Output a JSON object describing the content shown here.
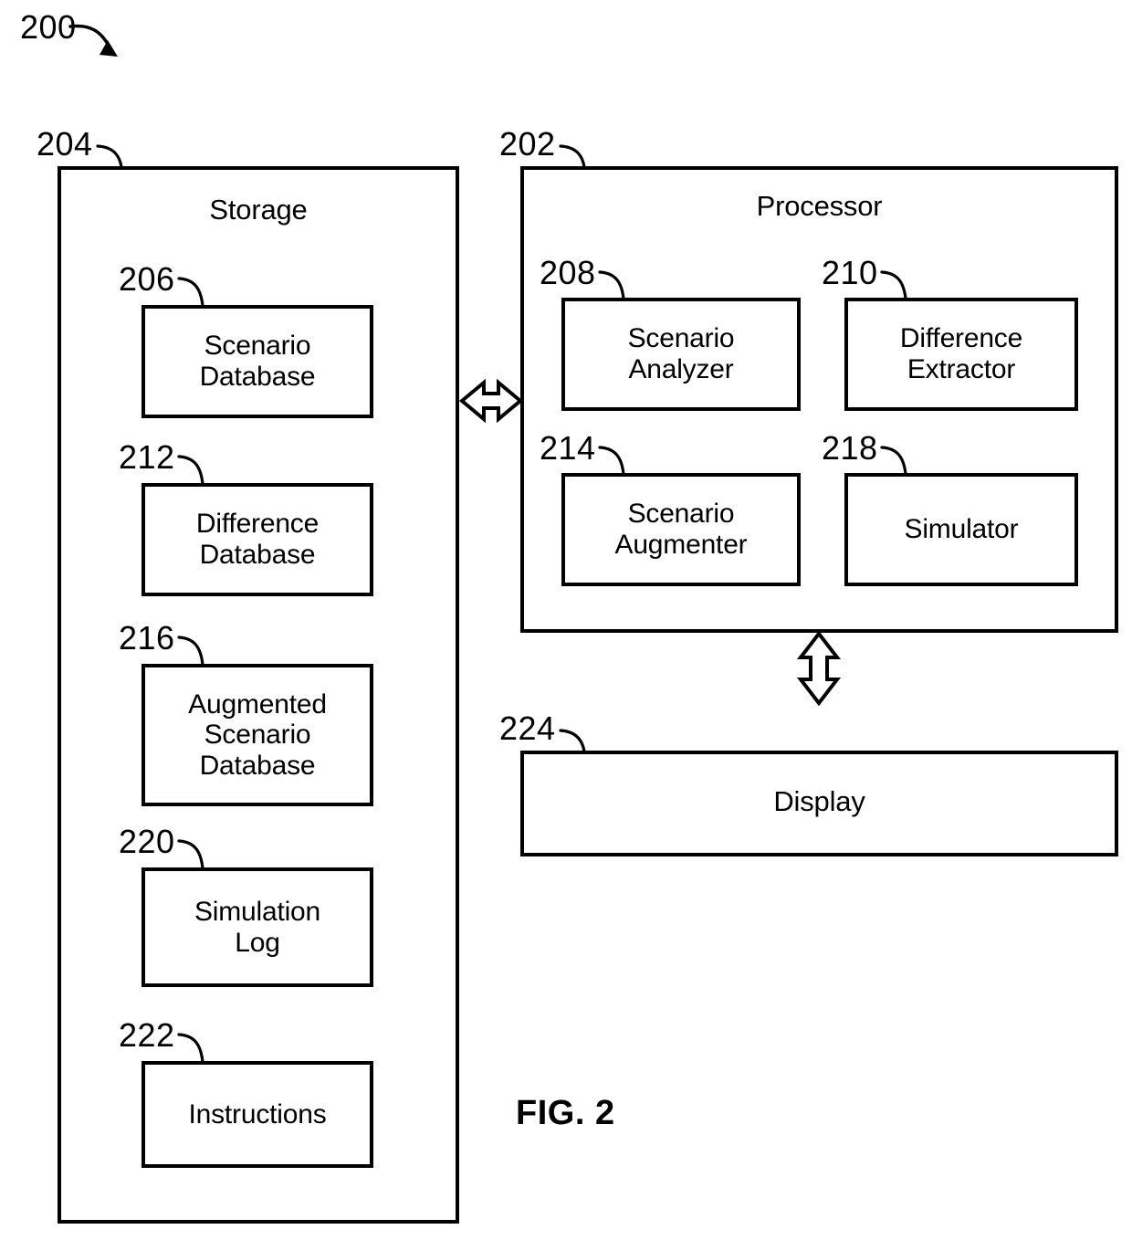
{
  "figure": {
    "caption": "FIG. 2",
    "system_ref": "200"
  },
  "storage": {
    "ref": "204",
    "title": "Storage",
    "components": [
      {
        "ref": "206",
        "label": "Scenario\nDatabase"
      },
      {
        "ref": "212",
        "label": "Difference\nDatabase"
      },
      {
        "ref": "216",
        "label": "Augmented\nScenario\nDatabase"
      },
      {
        "ref": "220",
        "label": "Simulation\nLog"
      },
      {
        "ref": "222",
        "label": "Instructions"
      }
    ]
  },
  "processor": {
    "ref": "202",
    "title": "Processor",
    "components": [
      {
        "ref": "208",
        "label": "Scenario\nAnalyzer"
      },
      {
        "ref": "210",
        "label": "Difference\nExtractor"
      },
      {
        "ref": "214",
        "label": "Scenario\nAugmenter"
      },
      {
        "ref": "218",
        "label": "Simulator"
      }
    ]
  },
  "display": {
    "ref": "224",
    "title": "Display"
  },
  "connections": [
    {
      "name": "storage-processor-bus",
      "type": "bidirectional-arrow",
      "orientation": "horizontal"
    },
    {
      "name": "processor-display-bus",
      "type": "bidirectional-arrow",
      "orientation": "vertical"
    }
  ],
  "colors": {
    "line": "#000000",
    "background": "#ffffff"
  }
}
